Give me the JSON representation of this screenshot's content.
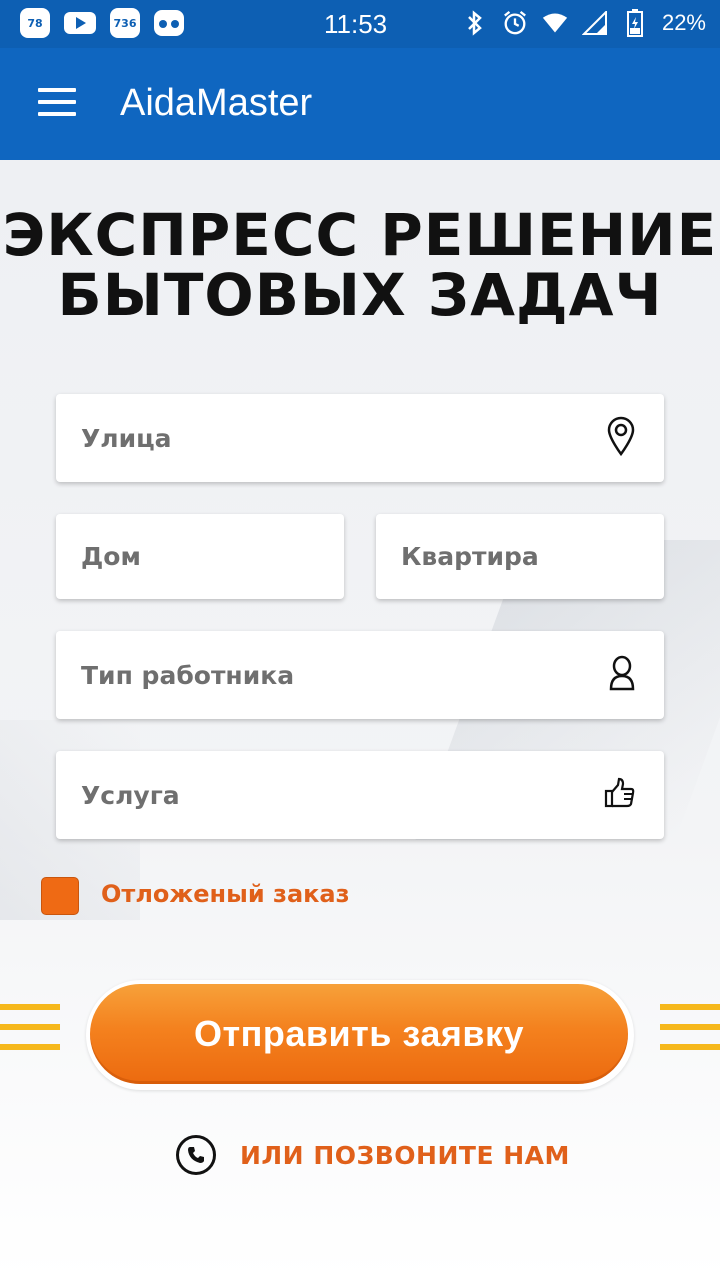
{
  "status_bar": {
    "badge1": "78",
    "badge2": "736",
    "time": "11:53",
    "battery": "22%"
  },
  "app_bar": {
    "title": "AidaMaster"
  },
  "headline": {
    "line1": "ЭКСПРЕСС РЕШЕНИЕ",
    "line2": "БЫТОВЫХ ЗАДАЧ"
  },
  "form": {
    "street": "Улица",
    "house": "Дом",
    "flat": "Квартира",
    "worker_type": "Тип работника",
    "service": "Услуга",
    "deferred_label": "Отложеный заказ",
    "submit_label": "Отправить заявку"
  },
  "call": {
    "label": "ИЛИ ПОЗВОНИТЕ НАМ"
  },
  "colors": {
    "app_bar": "#0f66c0",
    "accent": "#f4811e",
    "accent_text": "#e0601a",
    "stripes": "#f6b81c"
  }
}
